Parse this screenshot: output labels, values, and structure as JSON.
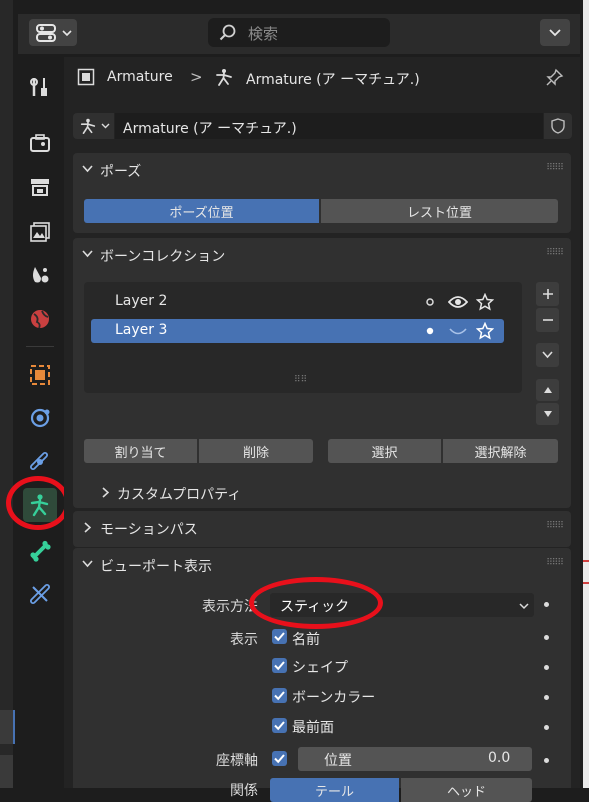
{
  "topbar": {
    "search_placeholder": "検索"
  },
  "breadcrumb": {
    "object": "Armature",
    "separator": ">",
    "data": "Armature (ア ーマチュア.)"
  },
  "datablock": {
    "name": "Armature (ア ーマチュア.)"
  },
  "pose_panel": {
    "title": "ポーズ",
    "pose_position": "ポーズ位置",
    "rest_position": "レスト位置"
  },
  "bone_collections": {
    "title": "ボーンコレクション",
    "items": [
      {
        "label": "Layer 2",
        "selected": false
      },
      {
        "label": "Layer 3",
        "selected": true
      }
    ],
    "assign": "割り当て",
    "remove": "削除",
    "select": "選択",
    "deselect": "選択解除",
    "custom_props": "カスタムプロパティ"
  },
  "motion_paths": {
    "title": "モーションパス"
  },
  "viewport_display": {
    "title": "ビューポート表示",
    "display_as_label": "表示方法",
    "display_as_value": "スティック",
    "show_label": "表示",
    "show_names": "名前",
    "show_shapes": "シェイプ",
    "show_bone_colors": "ボーンカラー",
    "in_front": "最前面",
    "axes_label": "座標軸",
    "axes_position_label": "位置",
    "axes_position_value": "0.0",
    "relations_label": "関係",
    "tail_label": "テール",
    "head_label": "ヘッド"
  },
  "colors": {
    "accent_blue": "#4772b3",
    "highlight_red": "#e8101b",
    "panel_bg": "#303030",
    "window_bg": "#1d1d1d"
  }
}
